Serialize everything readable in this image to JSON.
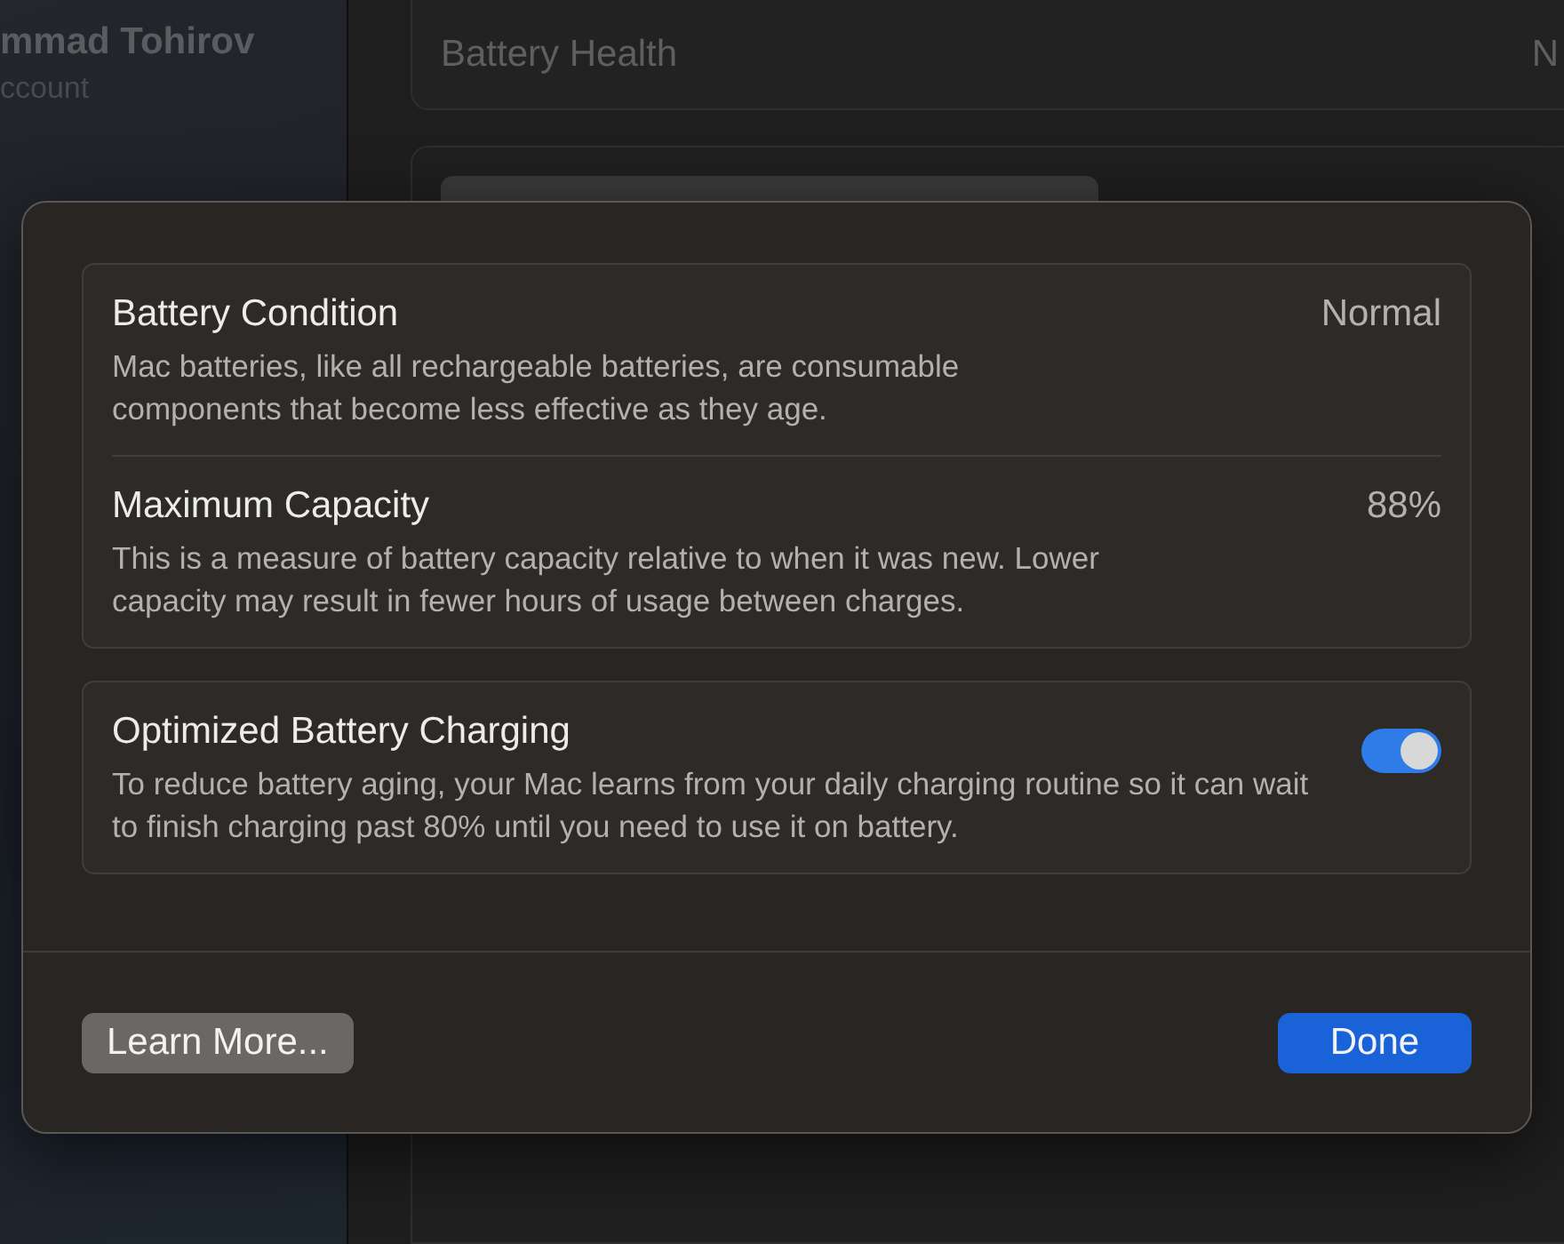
{
  "sidebar": {
    "user_name": "mmad Tohirov",
    "user_subtitle": "ccount"
  },
  "main": {
    "health_label": "Battery Health",
    "health_value": "N"
  },
  "dialog": {
    "groups": [
      {
        "rows": [
          {
            "kind": "info",
            "title": "Battery Condition",
            "value": "Normal",
            "description": "Mac batteries, like all rechargeable batteries, are consumable components that become less effective as they age."
          },
          {
            "kind": "info",
            "title": "Maximum Capacity",
            "value": "88%",
            "description": "This is a measure of battery capacity relative to when it was new. Lower capacity may result in fewer hours of usage between charges."
          }
        ]
      },
      {
        "rows": [
          {
            "kind": "toggle",
            "title": "Optimized Battery Charging",
            "on": true,
            "description": "To reduce battery aging, your Mac learns from your daily charging routine so it can wait to finish charging past 80% until you need to use it on battery."
          }
        ]
      }
    ],
    "buttons": [
      {
        "label": "Learn More...",
        "primary": false
      },
      {
        "label": "Done",
        "primary": true
      }
    ]
  }
}
